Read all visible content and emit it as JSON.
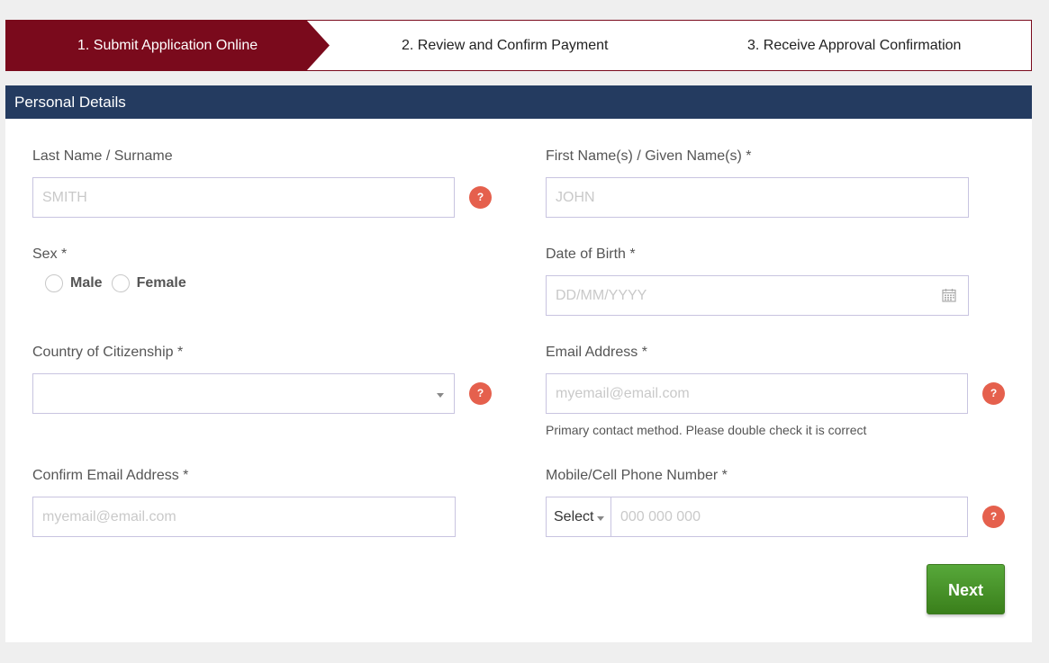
{
  "steps": [
    {
      "label": "1. Submit Application Online",
      "active": true
    },
    {
      "label": "2. Review and Confirm Payment",
      "active": false
    },
    {
      "label": "3. Receive Approval Confirmation",
      "active": false
    }
  ],
  "section": {
    "title": "Personal Details"
  },
  "fields": {
    "last_name": {
      "label": "Last Name / Surname",
      "placeholder": "SMITH",
      "value": ""
    },
    "first_name": {
      "label": "First Name(s) / Given Name(s) *",
      "placeholder": "JOHN",
      "value": ""
    },
    "sex": {
      "label": "Sex *",
      "options": [
        "Male",
        "Female"
      ],
      "selected": ""
    },
    "dob": {
      "label": "Date of Birth *",
      "placeholder": "DD/MM/YYYY",
      "value": ""
    },
    "citizenship": {
      "label": "Country of Citizenship *",
      "value": ""
    },
    "email": {
      "label": "Email Address *",
      "placeholder": "myemail@email.com",
      "value": "",
      "hint": "Primary contact method. Please double check it is correct"
    },
    "confirm_email": {
      "label": "Confirm Email Address *",
      "placeholder": "myemail@email.com",
      "value": ""
    },
    "phone": {
      "label": "Mobile/Cell Phone Number *",
      "code_select": "Select",
      "placeholder": "000 000 000",
      "value": ""
    }
  },
  "help_glyph": "?",
  "buttons": {
    "next": "Next"
  },
  "colors": {
    "step_active": "#7a0a1c",
    "header": "#243b60",
    "help": "#e5604d",
    "next": "#4a9a2a"
  },
  "icons": [
    "calendar-icon",
    "chevron-down-icon",
    "help-icon"
  ]
}
